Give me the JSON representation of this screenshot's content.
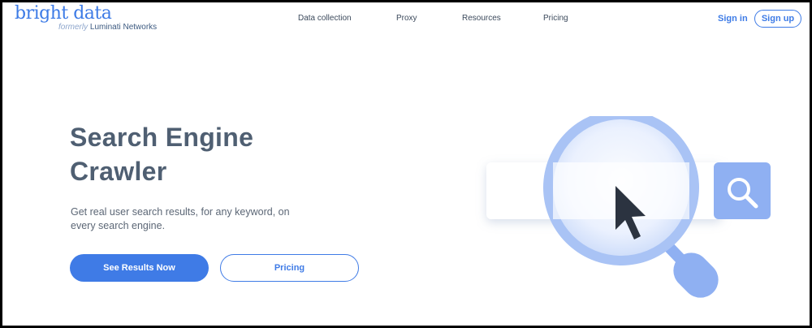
{
  "brand": {
    "name": "bright data",
    "formerly_prefix": "formerly",
    "formerly_name": "Luminati Networks",
    "accent": "#3d7be6"
  },
  "nav": {
    "items": [
      "Data collection",
      "Proxy",
      "Resources",
      "Pricing"
    ],
    "sign_in": "Sign in",
    "sign_up": "Sign up"
  },
  "hero": {
    "title_line1": "Search Engine",
    "title_line2": "Crawler",
    "description": "Get real user search results, for any keyword, on every search engine.",
    "primary_button": "See Results Now",
    "secondary_button": "Pricing"
  },
  "illustration": {
    "icons": [
      "search-icon",
      "magnifier-icon",
      "cursor-icon"
    ]
  }
}
